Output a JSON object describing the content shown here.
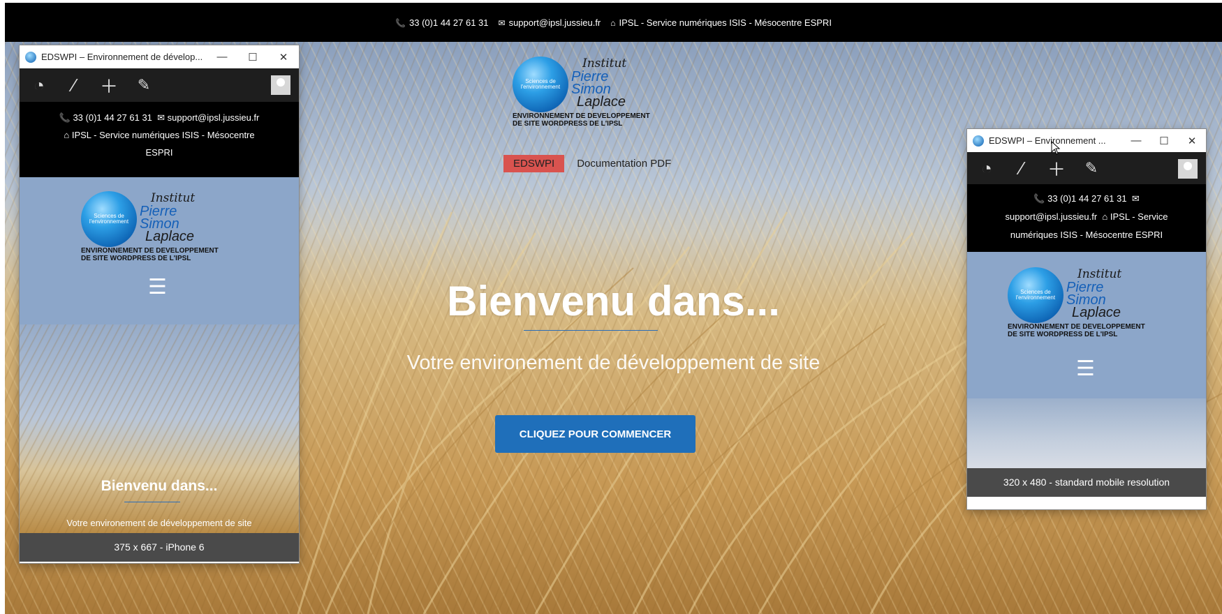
{
  "site": {
    "topbar": {
      "phone": "33 (0)1 44 27 61 31",
      "email": "support@ipsl.jussieu.fr",
      "org": "IPSL - Service numériques ISIS - Mésocentre ESPRI"
    },
    "logo": {
      "globe_text": "Sciences de l'environnement",
      "line1": "Institut",
      "line2": "Pierre",
      "line3": "Simon",
      "line4": "Laplace",
      "tagline1": "ENVIRONNEMENT DE DEVELOPPEMENT",
      "tagline2": "DE SITE WORDPRESS DE L'IPSL"
    },
    "nav": {
      "items": [
        "EDSWPI",
        "Documentation PDF"
      ]
    },
    "hero": {
      "title": "Bienvenu dans...",
      "subtitle": "Votre environement de développement de site",
      "cta": "CLIQUEZ POUR COMMENCER"
    }
  },
  "windows": [
    {
      "title": "EDSWPI – Environnement de dévelop...",
      "controls": [
        "—",
        "☐",
        "✕"
      ],
      "toolbar_icons": [
        "dashboard-icon",
        "brush-icon",
        "plus-icon",
        "pencil-icon",
        "avatar"
      ],
      "contact_line1": "33 (0)1 44 27 61 31",
      "contact_email": "support@ipsl.jussieu.fr",
      "contact_line2": "IPSL - Service numériques ISIS - Mésocentre",
      "contact_line3": "ESPRI",
      "hero_title": "Bienvenu dans...",
      "hero_subtitle": "Votre environement de développement de site",
      "footer": "375 x 667 - iPhone 6"
    },
    {
      "title": "EDSWPI – Environnement ...",
      "controls": [
        "—",
        "☐",
        "✕"
      ],
      "toolbar_icons": [
        "dashboard-icon",
        "brush-icon",
        "plus-icon",
        "pencil-icon",
        "avatar"
      ],
      "contact_line1": "33 (0)1 44 27 61 31",
      "contact_email": "support@ipsl.jussieu.fr",
      "contact_line2": "IPSL - Service",
      "contact_line3": "numériques ISIS - Mésocentre ESPRI",
      "footer": "320 x 480 - standard mobile resolution"
    }
  ],
  "colors": {
    "topbar": "#000000",
    "nav_active": "#d9534f",
    "cta": "#1f6fba",
    "logo_blue": "#1560b8",
    "mobile_header": "#8ca6c9",
    "footer": "#4a4a4a"
  }
}
